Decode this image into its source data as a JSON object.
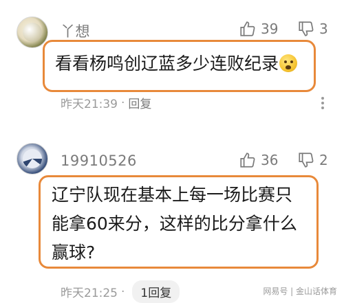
{
  "comments": [
    {
      "username": "丫想",
      "likes": "39",
      "dislikes": "3",
      "text": "看看杨鸣创辽蓝多少连败纪录",
      "emoji": "crying-face-icon",
      "time": "昨天21:39",
      "dot": "·",
      "reply": "回复"
    },
    {
      "username": "19910526",
      "likes": "36",
      "dislikes": "2",
      "text": "辽宁队现在基本上每一场比赛只能拿60来分，这样的比分拿什么赢球?",
      "time": "昨天21:25",
      "dot": "·",
      "reply": "1回复"
    }
  ],
  "watermark": "网易号 | 金山话体育",
  "colors": {
    "highlight": "#e8893a",
    "meta": "#9a9a9a"
  }
}
